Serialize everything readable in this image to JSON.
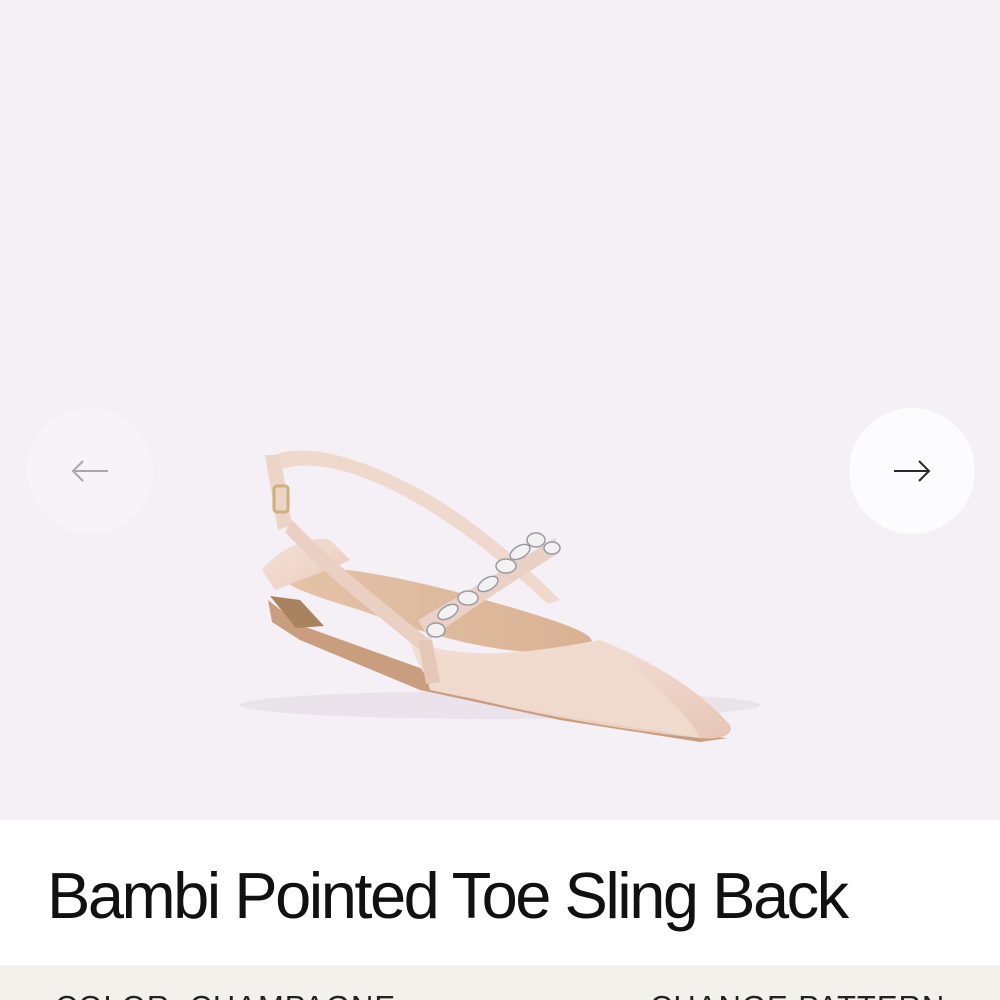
{
  "product": {
    "title": "Bambi Pointed Toe Sling Back",
    "image_alt": "Bambi Pointed Toe Sling Back in Champagne satin with crystal strap"
  },
  "gallery": {
    "prev_icon": "arrow-left-icon",
    "next_icon": "arrow-right-icon",
    "background_color": "#f5eff6"
  },
  "options": {
    "color_label": "COLOR",
    "color_separator": ":",
    "color_value": "CHAMPAGNE",
    "pattern_link": "CHANGE PATTERN"
  }
}
